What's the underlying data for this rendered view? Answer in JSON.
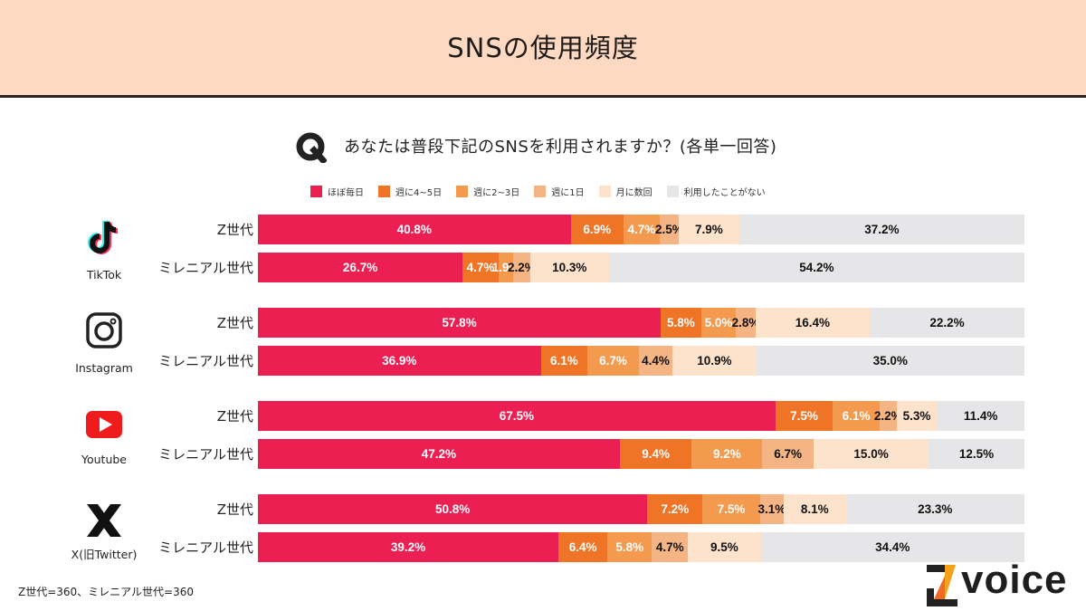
{
  "header": {
    "title": "SNSの使用頻度"
  },
  "question": {
    "icon": "q-icon",
    "text": "あなたは普段下記のSNSを利用されますか？(各単一回答)"
  },
  "footnote": "Z世代=360、ミレニアル世代=360",
  "logo": {
    "text": "voice",
    "icon": "z-logo-icon"
  },
  "colors": {
    "ほぼ毎日": "#ec1f52",
    "週に4~5日": "#ef7425",
    "週に2~3日": "#f39a4e",
    "週に1日": "#f5b484",
    "月に数回": "#fde2cc",
    "利用したことがない": "#e6e6e8"
  },
  "chart_data": {
    "type": "bar",
    "orientation": "horizontal",
    "stacked": true,
    "normalized": true,
    "title": "SNSの使用頻度",
    "subtitle": "あなたは普段下記のSNSを利用されますか？(各単一回答)",
    "xlabel": "",
    "ylabel": "",
    "xlim": [
      0,
      100
    ],
    "unit": "%",
    "legend_position": "top",
    "legend": [
      "ほぼ毎日",
      "週に4~5日",
      "週に2~3日",
      "週に1日",
      "月に数回",
      "利用したことがない"
    ],
    "groups": [
      {
        "platform": "TikTok",
        "icon": "tiktok-icon",
        "rows": [
          {
            "label": "Z世代",
            "values": [
              40.8,
              6.9,
              4.7,
              2.5,
              7.9,
              37.2
            ]
          },
          {
            "label": "ミレニアル世代",
            "values": [
              26.7,
              4.7,
              1.9,
              2.2,
              10.3,
              54.2
            ]
          }
        ]
      },
      {
        "platform": "Instagram",
        "icon": "instagram-icon",
        "rows": [
          {
            "label": "Z世代",
            "values": [
              57.8,
              5.8,
              5.0,
              2.8,
              16.4,
              22.2
            ]
          },
          {
            "label": "ミレニアル世代",
            "values": [
              36.9,
              6.1,
              6.7,
              4.4,
              10.9,
              35.0
            ]
          }
        ]
      },
      {
        "platform": "Youtube",
        "icon": "youtube-icon",
        "rows": [
          {
            "label": "Z世代",
            "values": [
              67.5,
              7.5,
              6.1,
              2.2,
              5.3,
              11.4
            ]
          },
          {
            "label": "ミレニアル世代",
            "values": [
              47.2,
              9.4,
              9.2,
              6.7,
              15.0,
              12.5
            ]
          }
        ]
      },
      {
        "platform": "X(旧Twitter)",
        "icon": "x-icon",
        "rows": [
          {
            "label": "Z世代",
            "values": [
              50.8,
              7.2,
              7.5,
              3.1,
              8.1,
              23.3
            ]
          },
          {
            "label": "ミレニアル世代",
            "values": [
              39.2,
              6.4,
              5.8,
              4.7,
              9.5,
              34.4
            ]
          }
        ]
      }
    ],
    "sample_sizes": {
      "Z世代": 360,
      "ミレニアル世代": 360
    }
  }
}
